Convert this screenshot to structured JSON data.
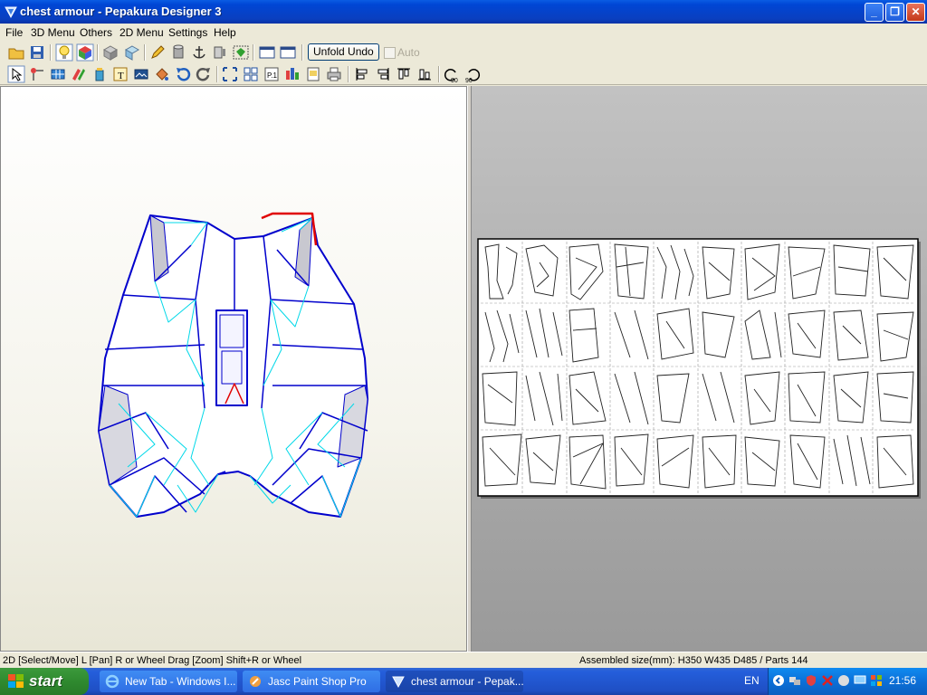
{
  "window": {
    "title": "chest armour - Pepakura Designer 3"
  },
  "menu": [
    "File",
    "3D Menu",
    "Others",
    "2D Menu",
    "Settings",
    "Help"
  ],
  "toolbar1": {
    "unfold_undo": "Unfold Undo",
    "auto_label": "Auto"
  },
  "toolbar2": {
    "rotate_left_label": "90",
    "rotate_right_label": "90"
  },
  "status": {
    "left": "2D [Select/Move] L [Pan] R or Wheel Drag [Zoom] Shift+R or Wheel",
    "right": "Assembled size(mm): H350 W435 D485 / Parts 144"
  },
  "taskbar": {
    "start": "start",
    "tasks": [
      "New Tab - Windows I...",
      "Jasc Paint Shop Pro",
      "chest armour - Pepak..."
    ],
    "language": "EN",
    "clock": "21:56"
  },
  "colors": {
    "model_edge": "#0000cc",
    "model_fold": "#00d8e8",
    "model_cut": "#e00000"
  }
}
